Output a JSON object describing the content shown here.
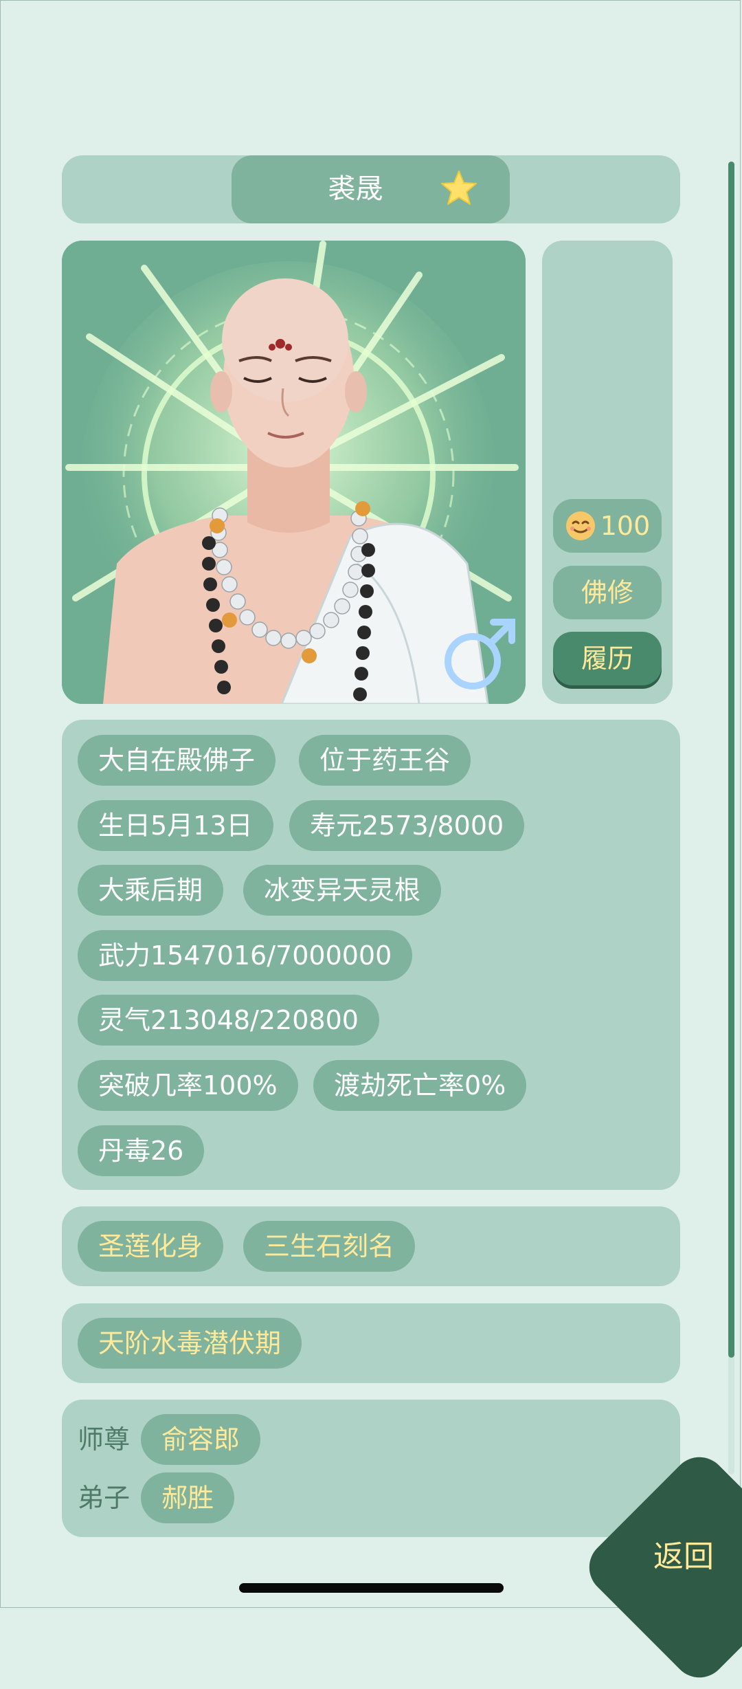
{
  "header": {
    "name": "裘晟",
    "favorite_icon": "star-icon"
  },
  "portrait": {
    "gender_icon": "male-symbol-icon"
  },
  "side": {
    "mood_value": "100",
    "mood_icon": "smiling-face-icon",
    "sect_label": "佛修",
    "history_label": "履历"
  },
  "info_chips": [
    "大自在殿佛子",
    "位于药王谷",
    "生日5月13日",
    "寿元2573/8000",
    "大乘后期",
    "冰变异天灵根",
    "武力1547016/7000000",
    "灵气213048/220800",
    "突破几率100%",
    "渡劫死亡率0%",
    "丹毒26"
  ],
  "traits": [
    "圣莲化身",
    "三生石刻名"
  ],
  "status_effects": [
    "天阶水毒潜伏期"
  ],
  "relations": {
    "master_label": "师尊",
    "master_name": "俞容郎",
    "disciple_label": "弟子",
    "disciple_name": "郝胜"
  },
  "back_label": "返回",
  "colors": {
    "background": "#dff0ea",
    "panel": "#aed3c6",
    "chip": "#7fb39d",
    "accent_text": "#ffe99a",
    "dark_button": "#2f5a45"
  }
}
